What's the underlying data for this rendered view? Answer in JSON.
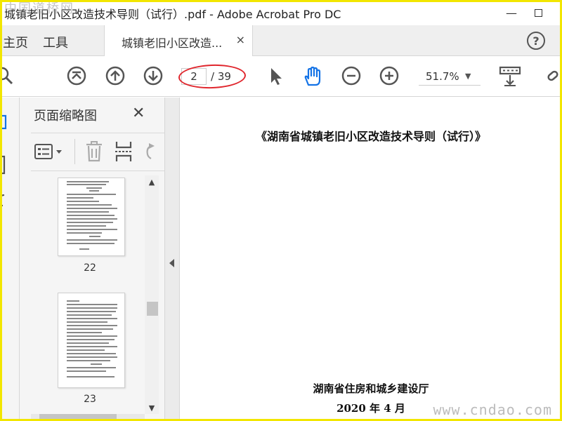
{
  "window": {
    "title": "城镇老旧小区改造技术导则（试行）.pdf - Adobe Acrobat Pro DC",
    "minimize_glyph": "—"
  },
  "tabs": {
    "home": "主页",
    "tools": "工具",
    "document": "城镇老旧小区改造...",
    "close_glyph": "×",
    "help_glyph": "?"
  },
  "toolbar": {
    "current_page": "2",
    "total_pages": "/ 39",
    "zoom": "51.7%",
    "zoom_caret": "▼",
    "icons": [
      "search-icon",
      "first-page-icon",
      "prev-page-icon",
      "next-page-icon",
      "select-cursor-icon",
      "hand-tool-icon",
      "zoom-out-icon",
      "zoom-in-icon",
      "page-display-icon",
      "link-icon"
    ],
    "hand_color": "#1473e6",
    "annotation_color": "#e0262d"
  },
  "thumbnails": {
    "title": "页面缩略图",
    "close_glyph": "✕",
    "pages": [
      {
        "label": "22"
      },
      {
        "label": "23"
      }
    ]
  },
  "document": {
    "title": "《湖南省城镇老旧小区改造技术导则（试行）》",
    "org": "湖南省住房和城乡建设厅",
    "date": "2020 年 4 月"
  },
  "watermarks": {
    "top_left": "中国道桥网",
    "bottom_right": "www.cndao.com"
  }
}
